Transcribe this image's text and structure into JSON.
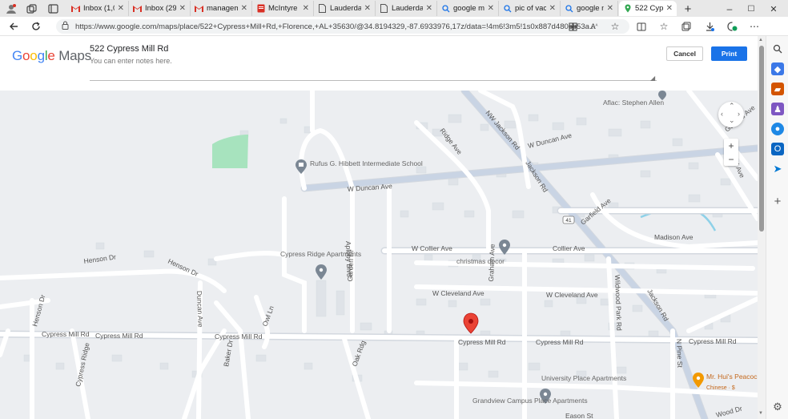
{
  "browser": {
    "tabs": [
      {
        "title": "Inbox (1,0",
        "icon": "gmail-icon",
        "active": false
      },
      {
        "title": "Inbox (29",
        "icon": "gmail-icon",
        "active": false
      },
      {
        "title": "manageme",
        "icon": "gmail-icon",
        "active": false
      },
      {
        "title": "McIntyre",
        "icon": "pdf-icon",
        "active": false
      },
      {
        "title": "Lauderda",
        "icon": "document-icon",
        "active": false
      },
      {
        "title": "Lauderda",
        "icon": "document-icon",
        "active": false
      },
      {
        "title": "google m",
        "icon": "search-icon",
        "active": false
      },
      {
        "title": "pic of vac",
        "icon": "search-icon",
        "active": false
      },
      {
        "title": "google m",
        "icon": "search-icon",
        "active": false
      },
      {
        "title": "522 Cypre",
        "icon": "maps-pin-icon",
        "active": true
      }
    ],
    "new_tab_glyph": "+",
    "window_controls": {
      "minimize": "–",
      "maximize": "☐",
      "close": "✕"
    },
    "url": "https://www.google.com/maps/place/522+Cypress+Mill+Rd,+Florence,+AL+35630/@34.8194329,-87.6933976,17z/data=!4m6!3m5!1s0x887d480cb53a..."
  },
  "print_header": {
    "logo_google": "Google",
    "logo_maps": "Maps",
    "place_title": "522 Cypress Mill Rd",
    "notes_placeholder": "You can enter notes here.",
    "cancel_label": "Cancel",
    "print_label": "Print"
  },
  "map": {
    "road_labels": [
      "W Duncan Ave",
      "W Duncan Ave",
      "NW Jackson Rd",
      "Ridge Ave",
      "Jackson Rd",
      "Garfield Ave",
      "Garfield Ave",
      "Madison Ave",
      "Sheffield Ave",
      "Henson Dr",
      "Henson Dr",
      "Henson Dr",
      "Duncan Ave",
      "Apleby Blvd",
      "Garden Dr",
      "W Collier Ave",
      "Collier Ave",
      "W Cleveland Ave",
      "W Cleveland Ave",
      "Graham Ave",
      "Wildwood Park Rd",
      "Jackson Rd",
      "Cypress Mill Rd",
      "Cypress Mill Rd",
      "Cypress Mill Rd",
      "Cypress Mill Rd",
      "Cypress Mill Rd",
      "Cypress Mill Rd",
      "Owl Ln",
      "Oak Rdg",
      "Baker Dr",
      "N Pine St",
      "Eason St",
      "Wood Dr",
      "Cypress Ridge"
    ],
    "pois": [
      {
        "name": "Aflac: Stephen Allen",
        "kind": "place"
      },
      {
        "name": "Rufus G. Hibbett Intermediate School",
        "kind": "school"
      },
      {
        "name": "Cypress Ridge Apartments",
        "kind": "place"
      },
      {
        "name": "christmas decor",
        "kind": "place"
      },
      {
        "name": "University Place Apartments",
        "kind": "place"
      },
      {
        "name": "Grandview Campus Place Apartments",
        "kind": "place"
      },
      {
        "name": "Mr. Hui's Peacock Express",
        "kind": "restaurant",
        "subtitle": "Chinese · $"
      }
    ],
    "route_shield": "41",
    "zoom_in": "+",
    "zoom_out": "−"
  },
  "colors": {
    "map_bg": "#eceef1",
    "road": "#ffffff",
    "road_casing": "#d3d8df",
    "arterial": "#c9d4e4",
    "park": "#a7e3be",
    "water": "#8ed1e8",
    "pin": "#ea4335",
    "print_button": "#1a73e8"
  }
}
